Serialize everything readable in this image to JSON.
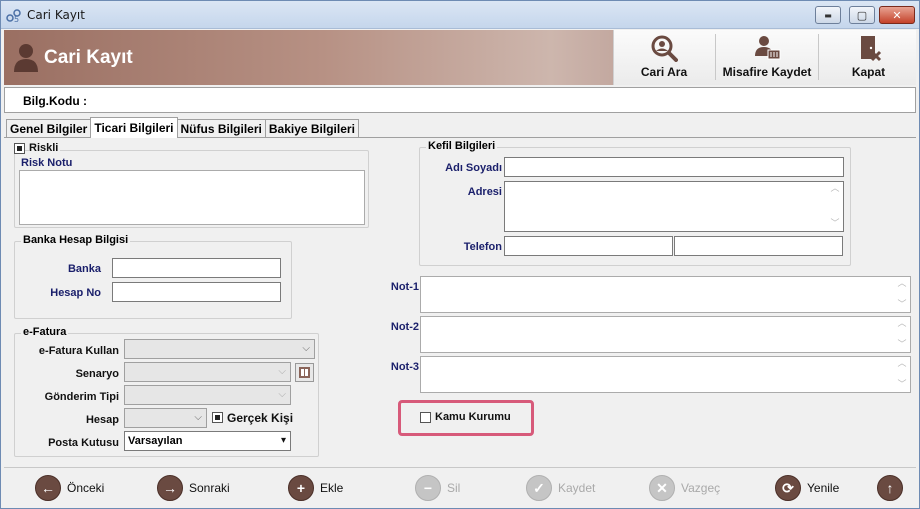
{
  "window": {
    "title": "Cari Kayıt",
    "min_glyph": "▬",
    "max_glyph": "▢",
    "close_glyph": "✕"
  },
  "header": {
    "title": "Cari Kayıt",
    "buttons": [
      {
        "label": "Cari Ara",
        "icon": "search-user-icon"
      },
      {
        "label": "Misafire Kaydet",
        "icon": "guest-save-icon"
      },
      {
        "label": "Kapat",
        "icon": "close-door-icon"
      }
    ]
  },
  "bilg": {
    "label": "Bilg.Kodu :"
  },
  "tabs": [
    {
      "label": "Genel Bilgiler",
      "active": false
    },
    {
      "label": "Ticari Bilgileri",
      "active": true
    },
    {
      "label": "Nüfus Bilgileri",
      "active": false
    },
    {
      "label": "Bakiye Bilgileri",
      "active": false
    }
  ],
  "risk": {
    "checkbox_label": "Riskli",
    "checked": true,
    "note_label": "Risk Notu"
  },
  "banka": {
    "group_title": "Banka Hesap Bilgisi",
    "banka_label": "Banka",
    "hesap_label": "Hesap No"
  },
  "efatura": {
    "group_title": "e-Fatura",
    "kullan_label": "e-Fatura Kullan",
    "senaryo_label": "Senaryo",
    "gonderim_label": "Gönderim Tipi",
    "hesap_label": "Hesap",
    "gercek_kisi_label": "Gerçek Kişi",
    "gercek_kisi_checked": true,
    "posta_label": "Posta Kutusu",
    "posta_value": "Varsayılan"
  },
  "kefil": {
    "group_title": "Kefil Bilgileri",
    "adi_label": "Adı Soyadı",
    "adres_label": "Adresi",
    "telefon_label": "Telefon"
  },
  "notes": {
    "not1": "Not-1",
    "not2": "Not-2",
    "not3": "Not-3"
  },
  "kamu": {
    "label": "Kamu Kurumu",
    "checked": false
  },
  "bottom": {
    "onceki": "Önceki",
    "sonraki": "Sonraki",
    "ekle": "Ekle",
    "sil": "Sil",
    "kaydet": "Kaydet",
    "vazgec": "Vazgeç",
    "yenile": "Yenile"
  },
  "colors": {
    "accent": "#6a4a41",
    "label_blue": "#1a1f6b",
    "highlight": "#d75a7a"
  }
}
